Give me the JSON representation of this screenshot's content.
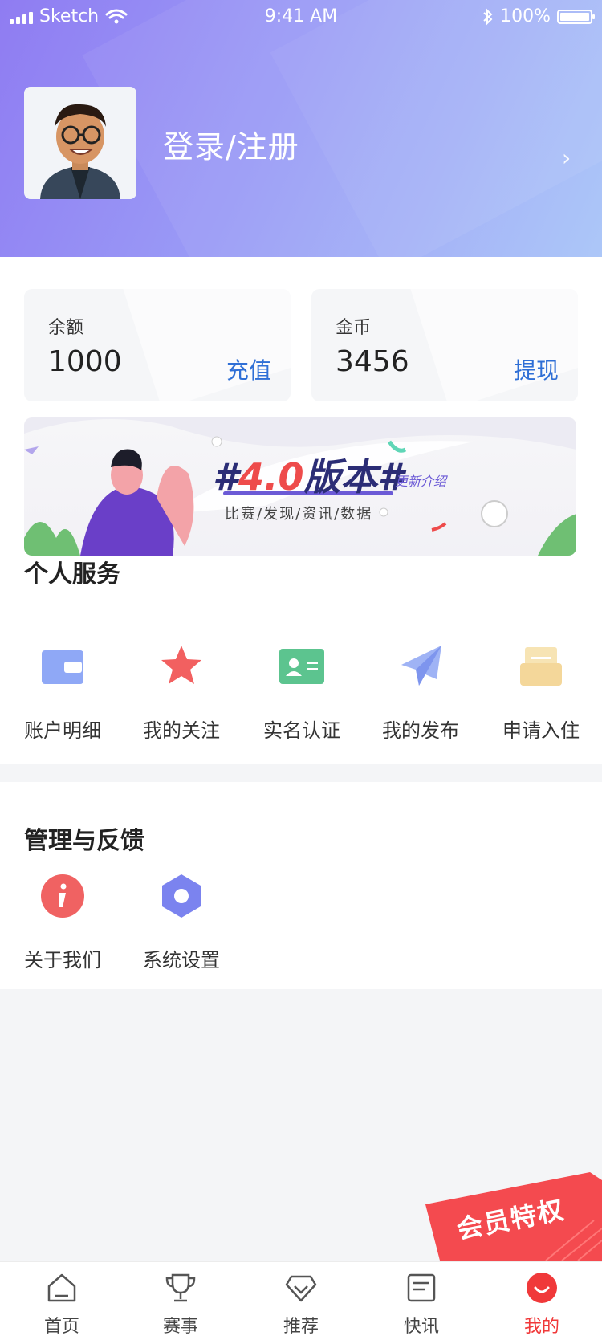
{
  "status_bar": {
    "carrier": "Sketch",
    "time": "9:41 AM",
    "battery": "100%"
  },
  "profile": {
    "login_label": "登录/注册"
  },
  "balance_card": {
    "label": "余额",
    "value": "1000",
    "action": "充值"
  },
  "coin_card": {
    "label": "金币",
    "value": "3456",
    "action": "提现"
  },
  "banner": {
    "hash_left": "#",
    "version": "4.0",
    "title_suffix": "版本",
    "hash_right": "#",
    "subtitle": "更新介绍",
    "tags": "比赛/发现/资讯/数据"
  },
  "personal_services": {
    "title": "个人服务",
    "items": [
      {
        "label": "账户明细",
        "icon": "wallet-icon"
      },
      {
        "label": "我的关注",
        "icon": "star-icon"
      },
      {
        "label": "实名认证",
        "icon": "id-card-icon"
      },
      {
        "label": "我的发布",
        "icon": "paper-plane-icon"
      },
      {
        "label": "申请入住",
        "icon": "inbox-icon"
      }
    ]
  },
  "management": {
    "title": "管理与反馈",
    "items": [
      {
        "label": "关于我们",
        "icon": "info-icon"
      },
      {
        "label": "系统设置",
        "icon": "settings-hexagon-icon"
      }
    ]
  },
  "vip_badge": {
    "label": "会员特权"
  },
  "tab_bar": {
    "items": [
      {
        "label": "首页",
        "icon": "home-icon"
      },
      {
        "label": "赛事",
        "icon": "trophy-icon"
      },
      {
        "label": "推荐",
        "icon": "diamond-icon"
      },
      {
        "label": "快讯",
        "icon": "news-icon"
      },
      {
        "label": "我的",
        "icon": "profile-smile-icon",
        "active": true
      }
    ]
  },
  "colors": {
    "accent_blue": "#2f6fd6",
    "active_red": "#f0393a",
    "header_start": "#8f7cf2",
    "header_end": "#a8c4f8"
  }
}
